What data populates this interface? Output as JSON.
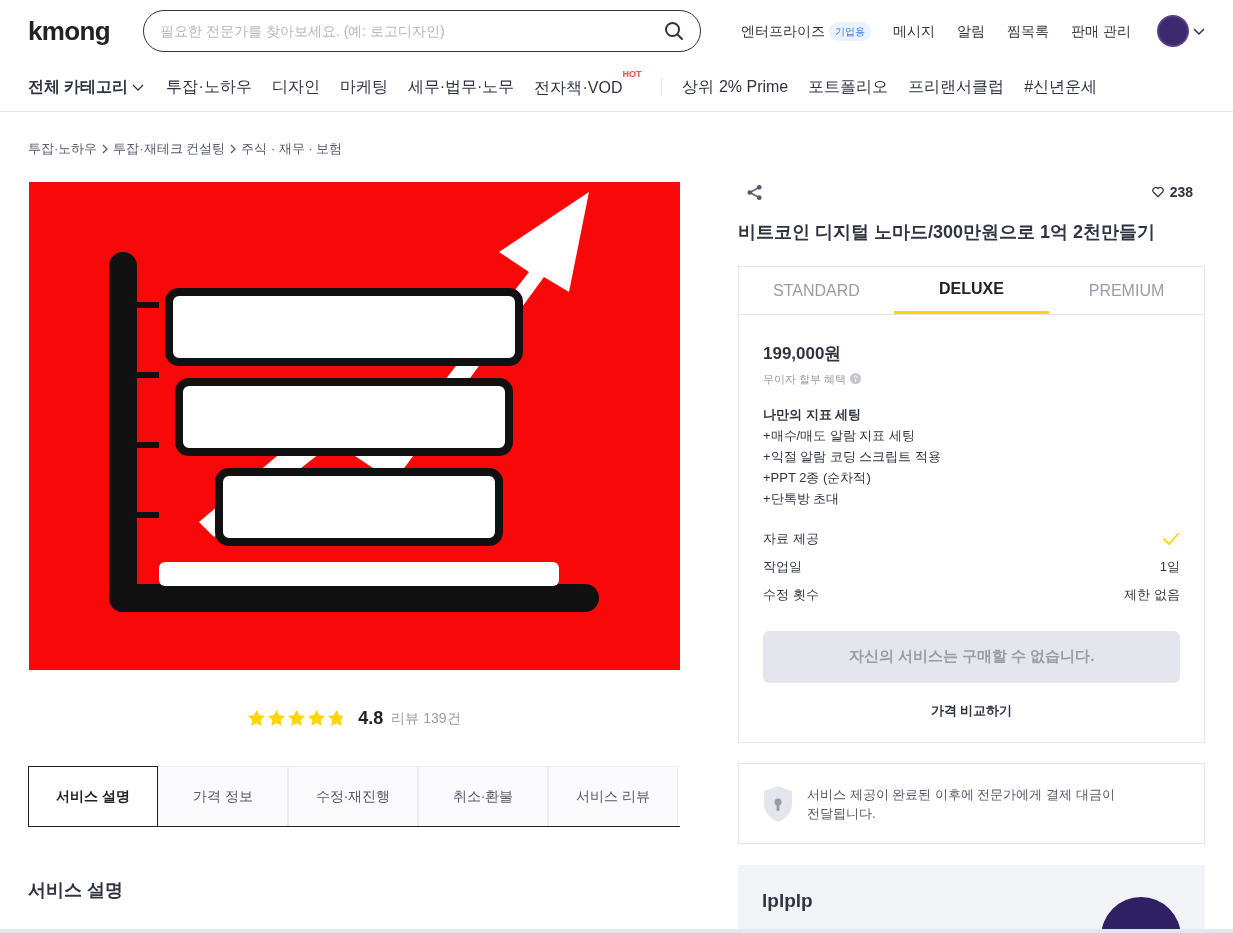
{
  "header": {
    "logo": "kmong",
    "search": {
      "placeholder": "필요한 전문가를 찾아보세요. (예: 로고디자인)"
    },
    "links": [
      {
        "label": "엔터프라이즈",
        "badge": "기업용"
      },
      {
        "label": "메시지"
      },
      {
        "label": "알림"
      },
      {
        "label": "찜목록"
      },
      {
        "label": "판매 관리"
      }
    ]
  },
  "category_nav": {
    "all": "전체 카테고리",
    "items": [
      {
        "label": "투잡·노하우"
      },
      {
        "label": "디자인"
      },
      {
        "label": "마케팅"
      },
      {
        "label": "세무·법무·노무"
      },
      {
        "label": "전자책·VOD",
        "badge": "HOT"
      },
      {
        "label": "상위 2% Prime",
        "divider_before": true
      },
      {
        "label": "포트폴리오"
      },
      {
        "label": "프리랜서클럽"
      },
      {
        "label": "#신년운세"
      }
    ]
  },
  "breadcrumb": [
    {
      "label": "투잡·노하우"
    },
    {
      "label": "투잡·재테크 컨설팅"
    },
    {
      "label": "주식 · 재무 · 보험"
    }
  ],
  "rating": {
    "stars": 4.8,
    "score": "4.8",
    "reviews": "리뷰 139건"
  },
  "detail_tabs": [
    {
      "label": "서비스 설명",
      "selected": true
    },
    {
      "label": "가격 정보",
      "selected": false
    },
    {
      "label": "수정·재진행",
      "selected": false
    },
    {
      "label": "취소·환불",
      "selected": false
    },
    {
      "label": "서비스 리뷰",
      "selected": false
    }
  ],
  "section_title": "서비스 설명",
  "product": {
    "likes": "238",
    "title": "비트코인 디지털 노마드/300만원으로 1억 2천만들기"
  },
  "packages": {
    "tabs": [
      {
        "label": "STANDARD",
        "selected": false
      },
      {
        "label": "DELUXE",
        "selected": true
      },
      {
        "label": "PREMIUM",
        "selected": false
      }
    ],
    "price": "199,000원",
    "installment": "무이자 할부 혜택",
    "name": "나만의 지표 세팅",
    "features": [
      "+매수/매도 알람 지표 세팅",
      "+익절 알람 코딩 스크립트 적용",
      "+PPT 2종 (순차적)",
      "+단톡방 초대"
    ],
    "specs": [
      {
        "label": "자료 제공",
        "kind": "check",
        "checked": true
      },
      {
        "label": "작업일",
        "kind": "text",
        "value": "1일"
      },
      {
        "label": "수정 횟수",
        "kind": "text",
        "value": "제한 없음"
      }
    ],
    "buy_button": {
      "label": "자신의 서비스는 구매할 수 없습니다.",
      "disabled": true
    },
    "compare": "가격 비교하기"
  },
  "notice": "서비스 제공이 완료된 이후에 전문가에게 결제 대금이 전달됩니다.",
  "seller": {
    "name": "lplplp"
  }
}
